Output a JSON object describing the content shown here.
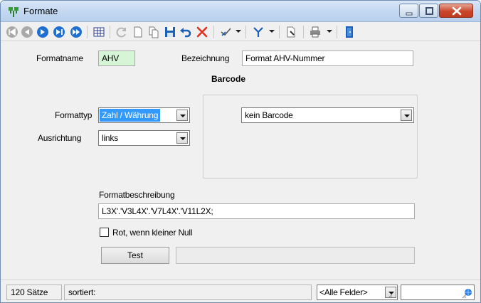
{
  "window": {
    "title": "Formate"
  },
  "toolbar": {
    "buttons": [
      "first-record-icon",
      "previous-record-icon",
      "next-record-icon",
      "last-record-icon",
      "grid-view-icon",
      "refresh-icon",
      "new-record-icon",
      "copy-record-icon",
      "save-icon",
      "undo-icon",
      "delete-icon",
      "select-icon",
      "filter-icon",
      "document-icon",
      "print-icon",
      "exit-icon"
    ]
  },
  "form": {
    "formatname_label": "Formatname",
    "formatname_value": "AHV",
    "bezeichnung_label": "Bezeichnung",
    "bezeichnung_value": "Format AHV-Nummer",
    "formattyp_label": "Formattyp",
    "formattyp_value": "Zahl / Währung",
    "ausrichtung_label": "Ausrichtung",
    "ausrichtung_value": "links",
    "barcode_title": "Barcode",
    "barcode_value": "kein Barcode",
    "formatbeschreibung_label": "Formatbeschreibung",
    "formatbeschreibung_value": "L3X'.'V3L4X'.'V7L4X'.'V11L2X;",
    "checkbox_label": "Rot, wenn kleiner Null",
    "checkbox_checked": false,
    "test_button": "Test",
    "test_result": ""
  },
  "statusbar": {
    "records": "120 Sätze",
    "sort": "sortiert:",
    "field_filter": "<Alle Felder>",
    "search_value": ""
  },
  "colors": {
    "accent_selection": "#3399ff",
    "green_field": "#d6f5d6",
    "close_button": "#c9462b"
  }
}
